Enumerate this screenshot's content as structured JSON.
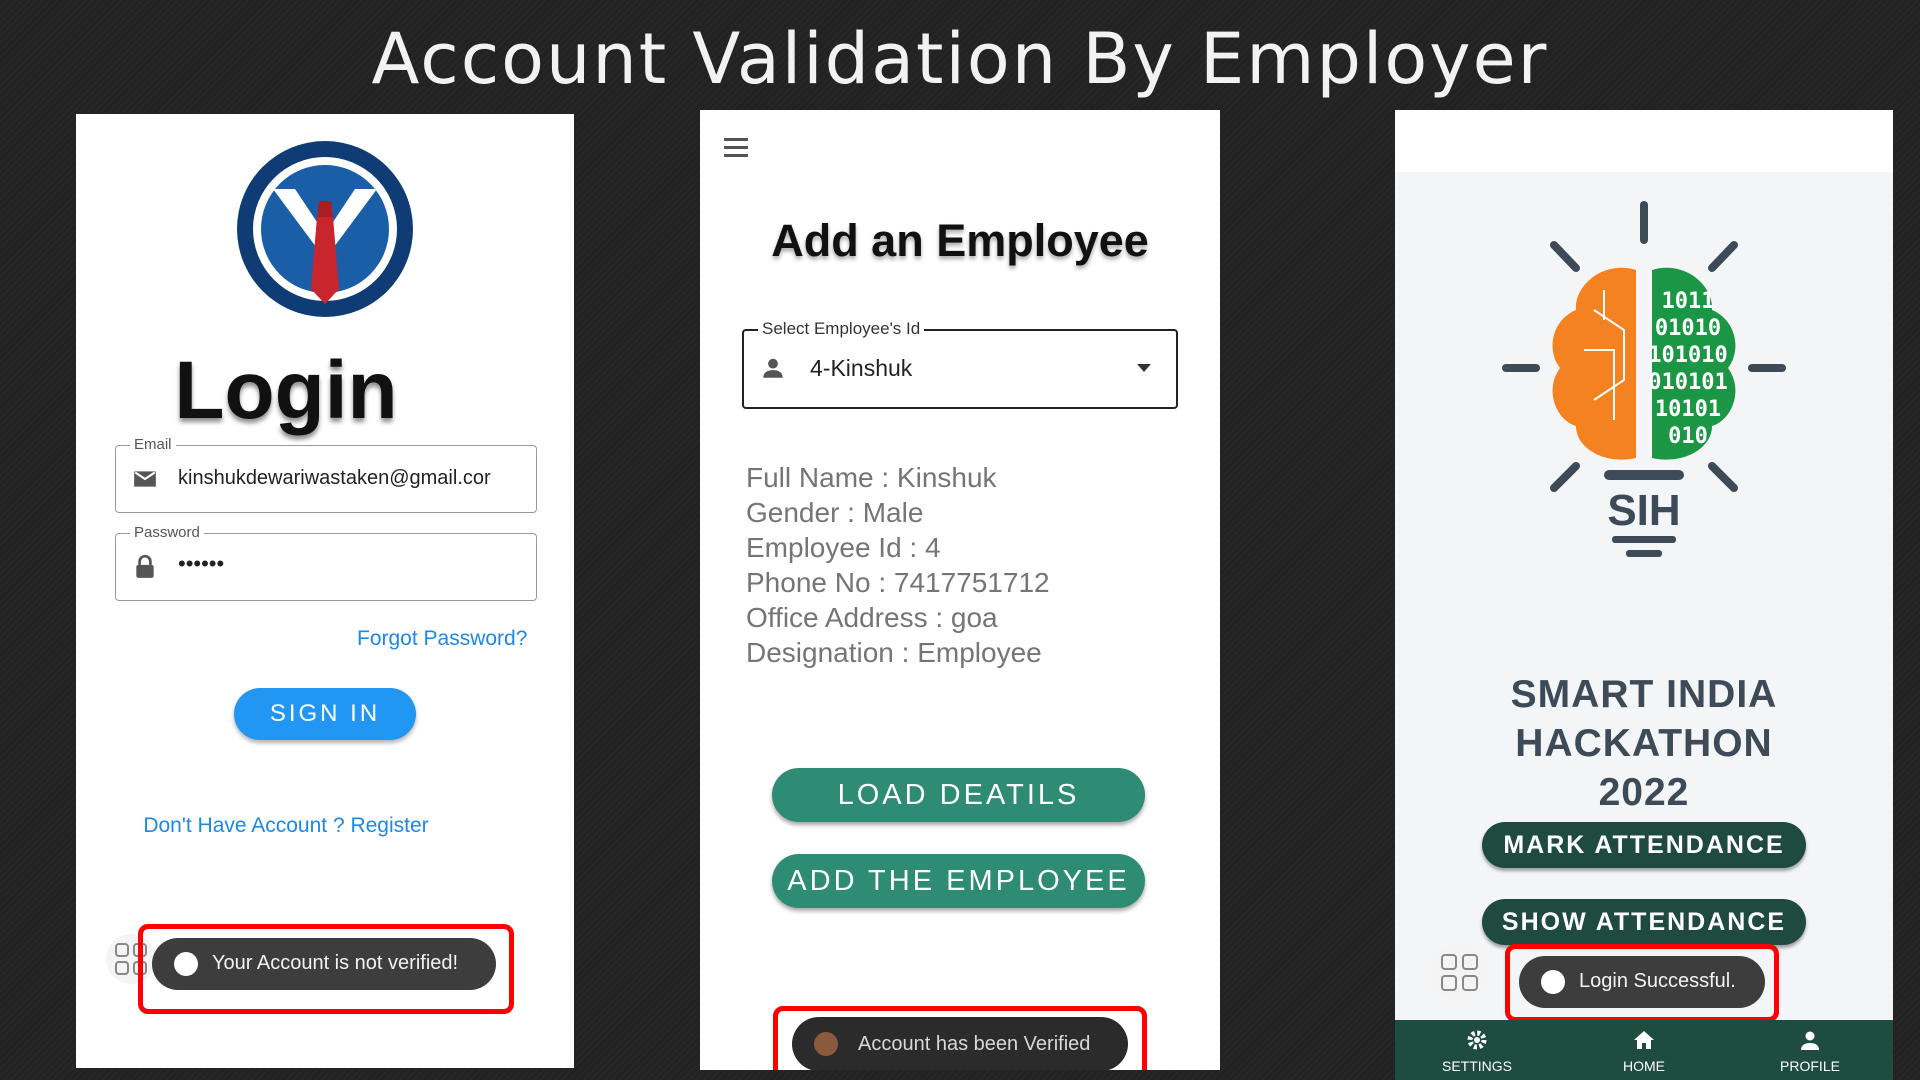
{
  "slide": {
    "title": "Account Validation By Employer"
  },
  "login": {
    "title": "Login",
    "email_label": "Email",
    "email_value": "kinshukdewariwastaken@gmail.cor",
    "password_label": "Password",
    "password_value": "••••••",
    "forgot": "Forgot Password?",
    "sign_in": "SIGN IN",
    "register": "Don't Have Account ? Register",
    "toast": "Your Account is not verified!"
  },
  "employee": {
    "title": "Add an Employee",
    "select_label": "Select Employee's Id",
    "select_value": "4-Kinshuk",
    "details": [
      "Full Name : Kinshuk",
      "Gender : Male",
      "Employee Id : 4",
      "Phone No : 7417751712",
      "Office Address : goa",
      "Designation : Employee"
    ],
    "load_button": "LOAD DEATILS",
    "add_button": "ADD THE EMPLOYEE",
    "toast": "Account has been Verified"
  },
  "home": {
    "logo_text": "SIH",
    "brain_digits": [
      "1011",
      "01010",
      "101010",
      "010101",
      "10101",
      "010"
    ],
    "title_lines": [
      "SMART INDIA",
      "HACKATHON",
      "2022"
    ],
    "mark_attendance": "MARK ATTENDANCE",
    "show_attendance": "SHOW ATTENDANCE",
    "toast": "Login Successful.",
    "nav": [
      "SETTINGS",
      "HOME",
      "PROFILE"
    ]
  },
  "colors": {
    "highlight": "#ff0000",
    "primary_blue": "#2196f3",
    "teal": "#2e8b74",
    "dark_green": "#1e4d3f",
    "orange": "#f58220",
    "green": "#1a9645"
  }
}
